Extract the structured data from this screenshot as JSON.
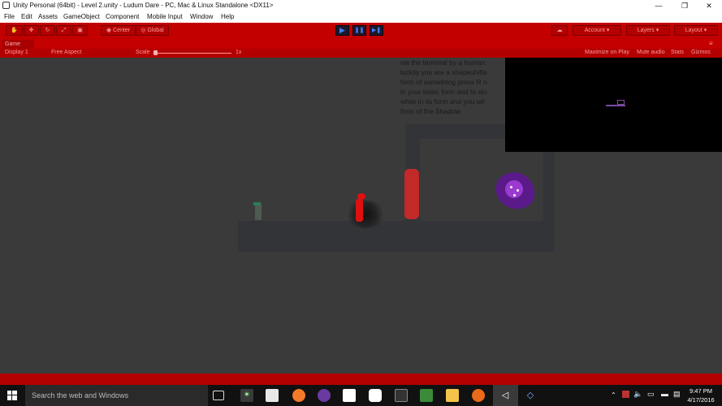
{
  "window": {
    "title": "Unity Personal (64bit) - Level 2.unity - Ludum Dare - PC, Mac & Linux Standalone <DX11>",
    "minimize_glyph": "—",
    "restore_glyph": "❐",
    "close_glyph": "✕"
  },
  "menu": [
    "File",
    "Edit",
    "Assets",
    "GameObject",
    "Component",
    "Mobile Input",
    "Window",
    "Help"
  ],
  "toolbar": {
    "center_label": "Center",
    "global_label": "Global",
    "account_label": "Account",
    "layers_label": "Layers",
    "layout_label": "Layout",
    "play_glyph": "▶",
    "pause_glyph": "❚❚",
    "step_glyph": "▶❚"
  },
  "game_tab": {
    "label": "Game",
    "display": "Display 1",
    "aspect": "Free Aspect",
    "scale_label": "Scale",
    "scale_value": "1x",
    "maximize": "Maximize on Play",
    "mute": "Mute audio",
    "stats": "Stats",
    "gizmos": "Gizmos"
  },
  "game": {
    "dialog_lines": [
      "via the terminal by a human",
      "luckily you are a shapeshifte",
      "form of something press R n",
      "in your basic form and to sto",
      "while in its form and you wil",
      "form of the Shadow"
    ]
  },
  "taskbar": {
    "search_placeholder": "Search the web and Windows",
    "time": "9:47 PM",
    "date": "4/17/2016"
  },
  "colors": {
    "editor_red": "#c20000",
    "viewport_bg": "#3a3a3a",
    "taskbar": "#111111"
  }
}
